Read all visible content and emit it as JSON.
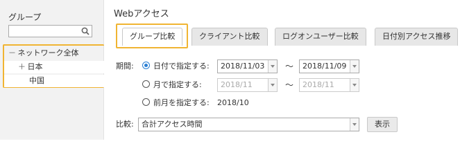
{
  "sidebar": {
    "title": "グループ",
    "search": {
      "value": "",
      "placeholder": ""
    },
    "tree": [
      {
        "toggle": "－",
        "label": "ネットワーク全体"
      },
      {
        "toggle": "＋",
        "label": "日本"
      },
      {
        "toggle": "",
        "label": "中国"
      }
    ]
  },
  "main": {
    "title": "Webアクセス",
    "tabs": [
      {
        "label": "グループ比較",
        "active": true
      },
      {
        "label": "クライアント比較"
      },
      {
        "label": "ログオンユーザー比較"
      },
      {
        "label": "日付別アクセス推移"
      }
    ],
    "period_label": "期間:",
    "options": [
      {
        "label": "日付で指定する:",
        "selected": true,
        "from": "2018/11/03",
        "to": "2018/11/09"
      },
      {
        "label": "月で指定する:",
        "selected": false,
        "from": "2018/11",
        "to": "2018/11"
      },
      {
        "label": "前月を指定する:",
        "selected": false,
        "value": "2018/10"
      }
    ],
    "tilde": "～",
    "compare_label": "比較:",
    "compare_value": "合計アクセス時間",
    "show_button": "表示"
  },
  "colors": {
    "highlight": "#f0b432",
    "radio_selected": "#2a7fd4"
  }
}
